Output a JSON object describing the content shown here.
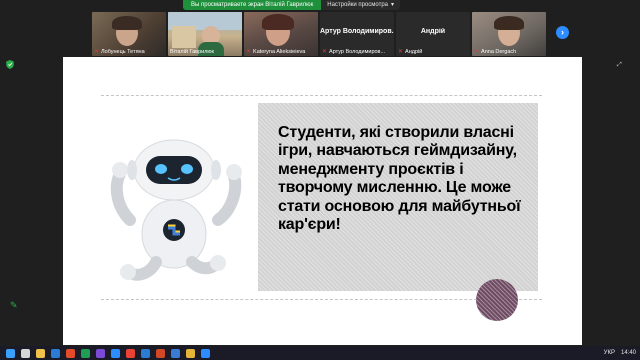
{
  "share_banner": {
    "message": "Вы просматриваете экран Віталій Гаврилюк",
    "settings_label": "Настройки просмотра"
  },
  "participants": [
    {
      "name": "Лобунець Тетяна",
      "video": true
    },
    {
      "name": "Віталій Гаврилюк",
      "video": true
    },
    {
      "name": "Kateryna Alieksieieva",
      "video": true
    },
    {
      "name": "Артур Володимирович",
      "display": "Артур Володимиров...",
      "video": false
    },
    {
      "name": "Андрій",
      "video": false
    },
    {
      "name": "Anna Dergach",
      "video": true
    }
  ],
  "slide": {
    "text": "Студенти, які створили власні ігри, навчаються геймдизайну, менеджменту проєктів і творчому мисленню. Це може стати основою для майбутньої кар'єри!"
  },
  "taskbar": {
    "language": "УКР",
    "time": "14:40"
  },
  "icons": {
    "security": "shield-icon",
    "annotate": "pencil-icon",
    "next": "chevron-right-icon",
    "fullscreen": "fullscreen-icon"
  },
  "colors": {
    "share_green": "#1e8f3a",
    "zoom_blue": "#2d8cff",
    "slide_panel": "#d2d2d2",
    "circle_accent": "#6e4a63"
  }
}
